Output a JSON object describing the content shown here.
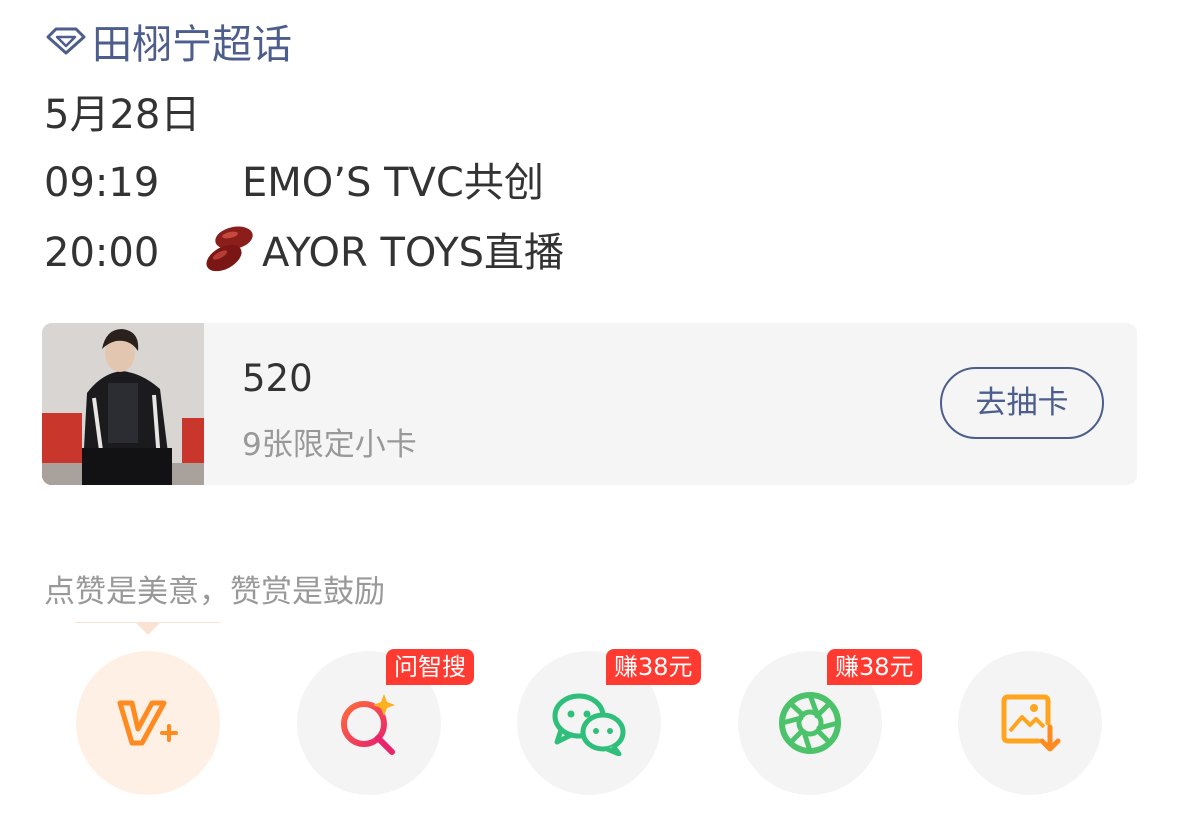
{
  "topic": {
    "icon": "diamond-icon",
    "label": "田栩宁超话",
    "color": "#4d5e8c"
  },
  "schedule": {
    "date": "5月28日",
    "items": [
      {
        "time": "09:19",
        "text": "EMO’S TVC共创"
      },
      {
        "time": "20:00",
        "icon": "beans-icon",
        "text": "AYOR TOYS直播"
      }
    ]
  },
  "card": {
    "title": "520",
    "subtitle": "9张限定小卡",
    "button": "去抽卡",
    "thumbnail": "person-photo"
  },
  "hint": "点赞是美意，赞赏是鼓励",
  "actions": [
    {
      "icon": "vplus-icon",
      "badge": ""
    },
    {
      "icon": "ai-search-icon",
      "badge": "问智搜"
    },
    {
      "icon": "wechat-icon",
      "badge": "赚38元"
    },
    {
      "icon": "moments-icon",
      "badge": "赚38元"
    },
    {
      "icon": "save-image-icon",
      "badge": ""
    }
  ],
  "colors": {
    "link": "#4d5e8c",
    "badge": "#ff3a30",
    "orange": "#ff8a1f",
    "green": "#4cc36a"
  }
}
